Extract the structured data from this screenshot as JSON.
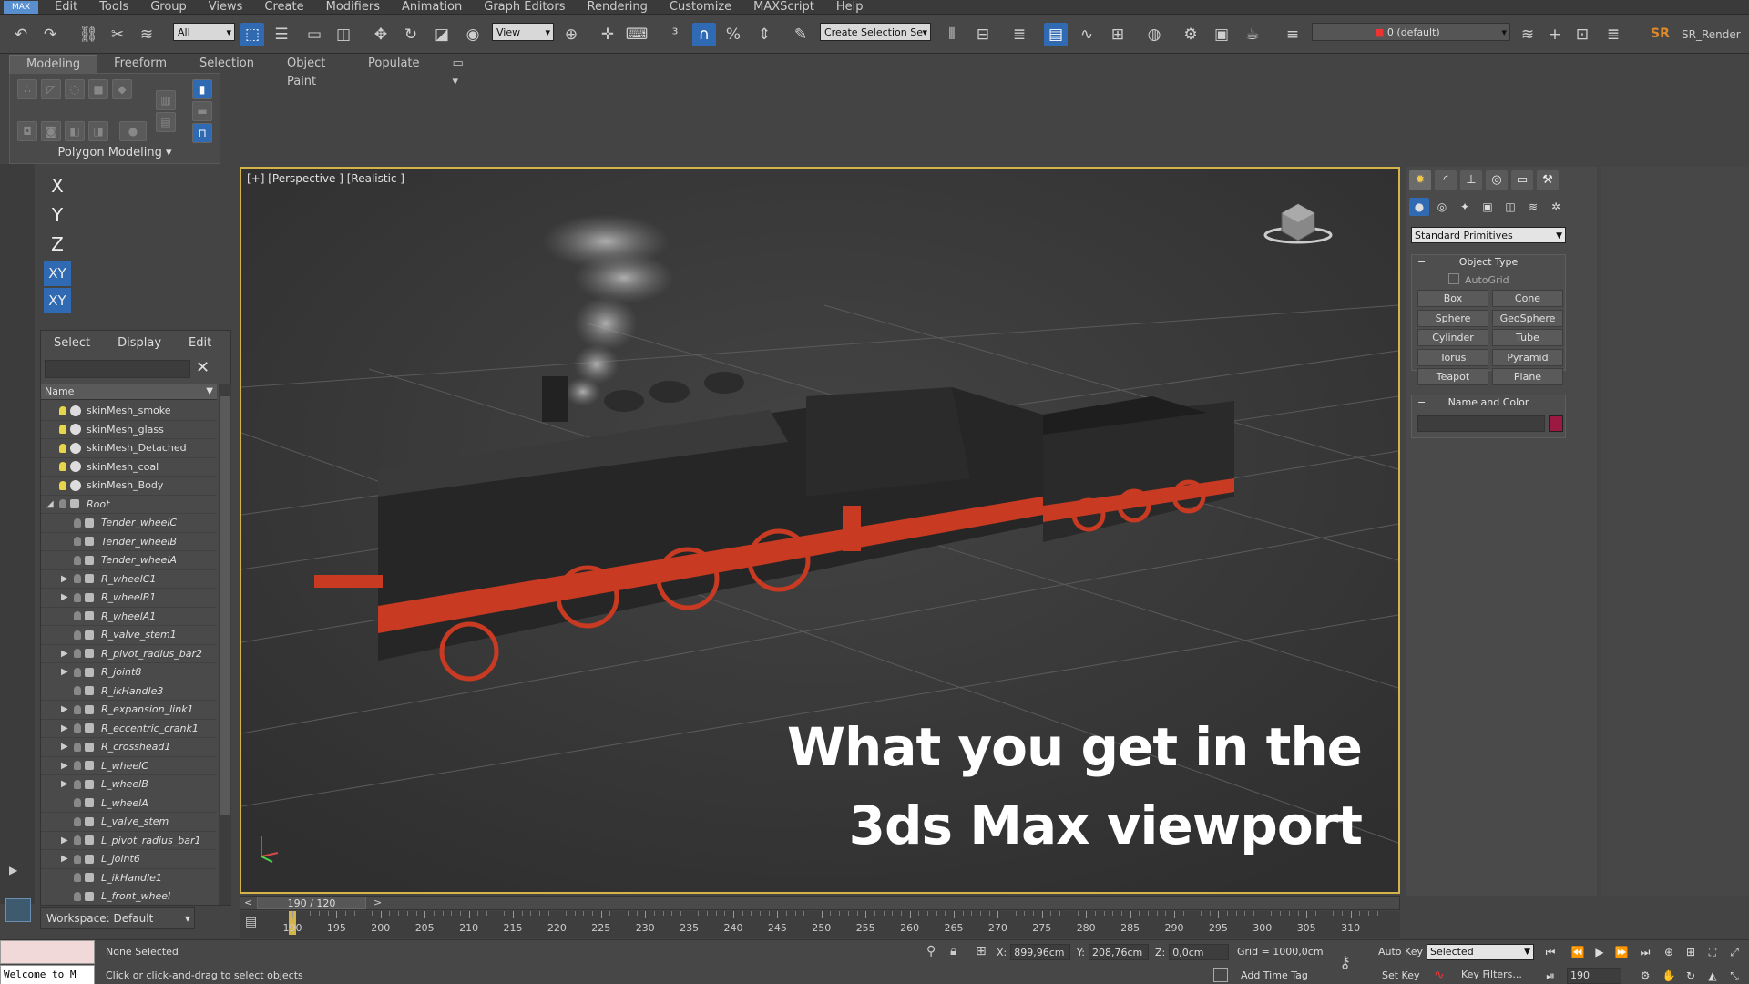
{
  "app": {
    "logo": "MAX"
  },
  "menu": [
    "Edit",
    "Tools",
    "Group",
    "Views",
    "Create",
    "Modifiers",
    "Animation",
    "Graph Editors",
    "Rendering",
    "Customize",
    "MAXScript",
    "Help"
  ],
  "toolbar": {
    "filter": "All",
    "refcoord": "View",
    "selection_set": "Create Selection Se",
    "layer": "0 (default)",
    "user_initials": "SR",
    "user_name": "SR_Render"
  },
  "ribbon": {
    "tabs": [
      "Modeling",
      "Freeform",
      "Selection",
      "Object Paint",
      "Populate"
    ],
    "panel_label": "Polygon Modeling"
  },
  "axis": [
    "X",
    "Y",
    "Z",
    "XY",
    "XY"
  ],
  "explorer": {
    "menu": [
      "Select",
      "Display",
      "Edit"
    ],
    "column": "Name",
    "rows": [
      {
        "name": "skinMesh_smoke",
        "kind": "mesh",
        "arrow": false,
        "depth": 0
      },
      {
        "name": "skinMesh_glass",
        "kind": "mesh",
        "arrow": false,
        "depth": 0
      },
      {
        "name": "skinMesh_Detached",
        "kind": "mesh",
        "arrow": false,
        "depth": 0
      },
      {
        "name": "skinMesh_coal",
        "kind": "mesh",
        "arrow": false,
        "depth": 0
      },
      {
        "name": "skinMesh_Body",
        "kind": "mesh",
        "arrow": false,
        "depth": 0
      },
      {
        "name": "Root",
        "kind": "root",
        "arrow": true,
        "depth": 0
      },
      {
        "name": "Tender_wheelC",
        "kind": "bone",
        "arrow": false,
        "depth": 1
      },
      {
        "name": "Tender_wheelB",
        "kind": "bone",
        "arrow": false,
        "depth": 1
      },
      {
        "name": "Tender_wheelA",
        "kind": "bone",
        "arrow": false,
        "depth": 1
      },
      {
        "name": "R_wheelC1",
        "kind": "bone",
        "arrow": true,
        "depth": 1
      },
      {
        "name": "R_wheelB1",
        "kind": "bone",
        "arrow": true,
        "depth": 1
      },
      {
        "name": "R_wheelA1",
        "kind": "bone",
        "arrow": false,
        "depth": 1
      },
      {
        "name": "R_valve_stem1",
        "kind": "bone",
        "arrow": false,
        "depth": 1
      },
      {
        "name": "R_pivot_radius_bar2",
        "kind": "bone",
        "arrow": true,
        "depth": 1
      },
      {
        "name": "R_joint8",
        "kind": "bone",
        "arrow": true,
        "depth": 1
      },
      {
        "name": "R_ikHandle3",
        "kind": "bone",
        "arrow": false,
        "depth": 1
      },
      {
        "name": "R_expansion_link1",
        "kind": "bone",
        "arrow": true,
        "depth": 1
      },
      {
        "name": "R_eccentric_crank1",
        "kind": "bone",
        "arrow": true,
        "depth": 1
      },
      {
        "name": "R_crosshead1",
        "kind": "bone",
        "arrow": true,
        "depth": 1
      },
      {
        "name": "L_wheelC",
        "kind": "bone",
        "arrow": true,
        "depth": 1
      },
      {
        "name": "L_wheelB",
        "kind": "bone",
        "arrow": true,
        "depth": 1
      },
      {
        "name": "L_wheelA",
        "kind": "bone",
        "arrow": false,
        "depth": 1
      },
      {
        "name": "L_valve_stem",
        "kind": "bone",
        "arrow": false,
        "depth": 1
      },
      {
        "name": "L_pivot_radius_bar1",
        "kind": "bone",
        "arrow": true,
        "depth": 1
      },
      {
        "name": "L_joint6",
        "kind": "bone",
        "arrow": true,
        "depth": 1
      },
      {
        "name": "L_ikHandle1",
        "kind": "bone",
        "arrow": false,
        "depth": 1
      },
      {
        "name": "L_front_wheel",
        "kind": "bone",
        "arrow": false,
        "depth": 1
      }
    ]
  },
  "workspace": "Workspace: Default",
  "viewport": {
    "label": "[+] [Perspective ] [Realistic ]",
    "caption_line1": "What you get in the",
    "caption_line2": "3ds Max viewport"
  },
  "command_panel": {
    "category": "Standard Primitives",
    "object_type_title": "Object Type",
    "autogrid": "AutoGrid",
    "buttons": [
      "Box",
      "Cone",
      "Sphere",
      "GeoSphere",
      "Cylinder",
      "Tube",
      "Torus",
      "Pyramid",
      "Teapot",
      "Plane"
    ],
    "name_color_title": "Name and Color",
    "object_color": "#9c1a42"
  },
  "timeline": {
    "slider": "190 / 120",
    "left": "<",
    "right": ">",
    "ticks": [
      "190",
      "195",
      "200",
      "205",
      "210",
      "215",
      "220",
      "225",
      "230",
      "235",
      "240",
      "245",
      "250",
      "255",
      "260",
      "265",
      "270",
      "275",
      "280",
      "285",
      "290",
      "295",
      "300",
      "305",
      "310"
    ]
  },
  "status": {
    "maxscript": "Welcome to M",
    "selection": "None Selected",
    "prompt": "Click or click-and-drag to select objects",
    "x_label": "X:",
    "x_value": "899,96cm",
    "y_label": "Y:",
    "y_value": "208,76cm",
    "z_label": "Z:",
    "z_value": "0,0cm",
    "grid": "Grid = 1000,0cm",
    "add_time_tag": "Add Time Tag",
    "auto_key": "Auto Key",
    "set_key": "Set Key",
    "selected": "Selected",
    "key_filters": "Key Filters...",
    "frame": "190"
  },
  "colors": {
    "accent": "#2f6ab3",
    "viewport_border": "#d4b44a",
    "train_red": "#c83a22"
  }
}
